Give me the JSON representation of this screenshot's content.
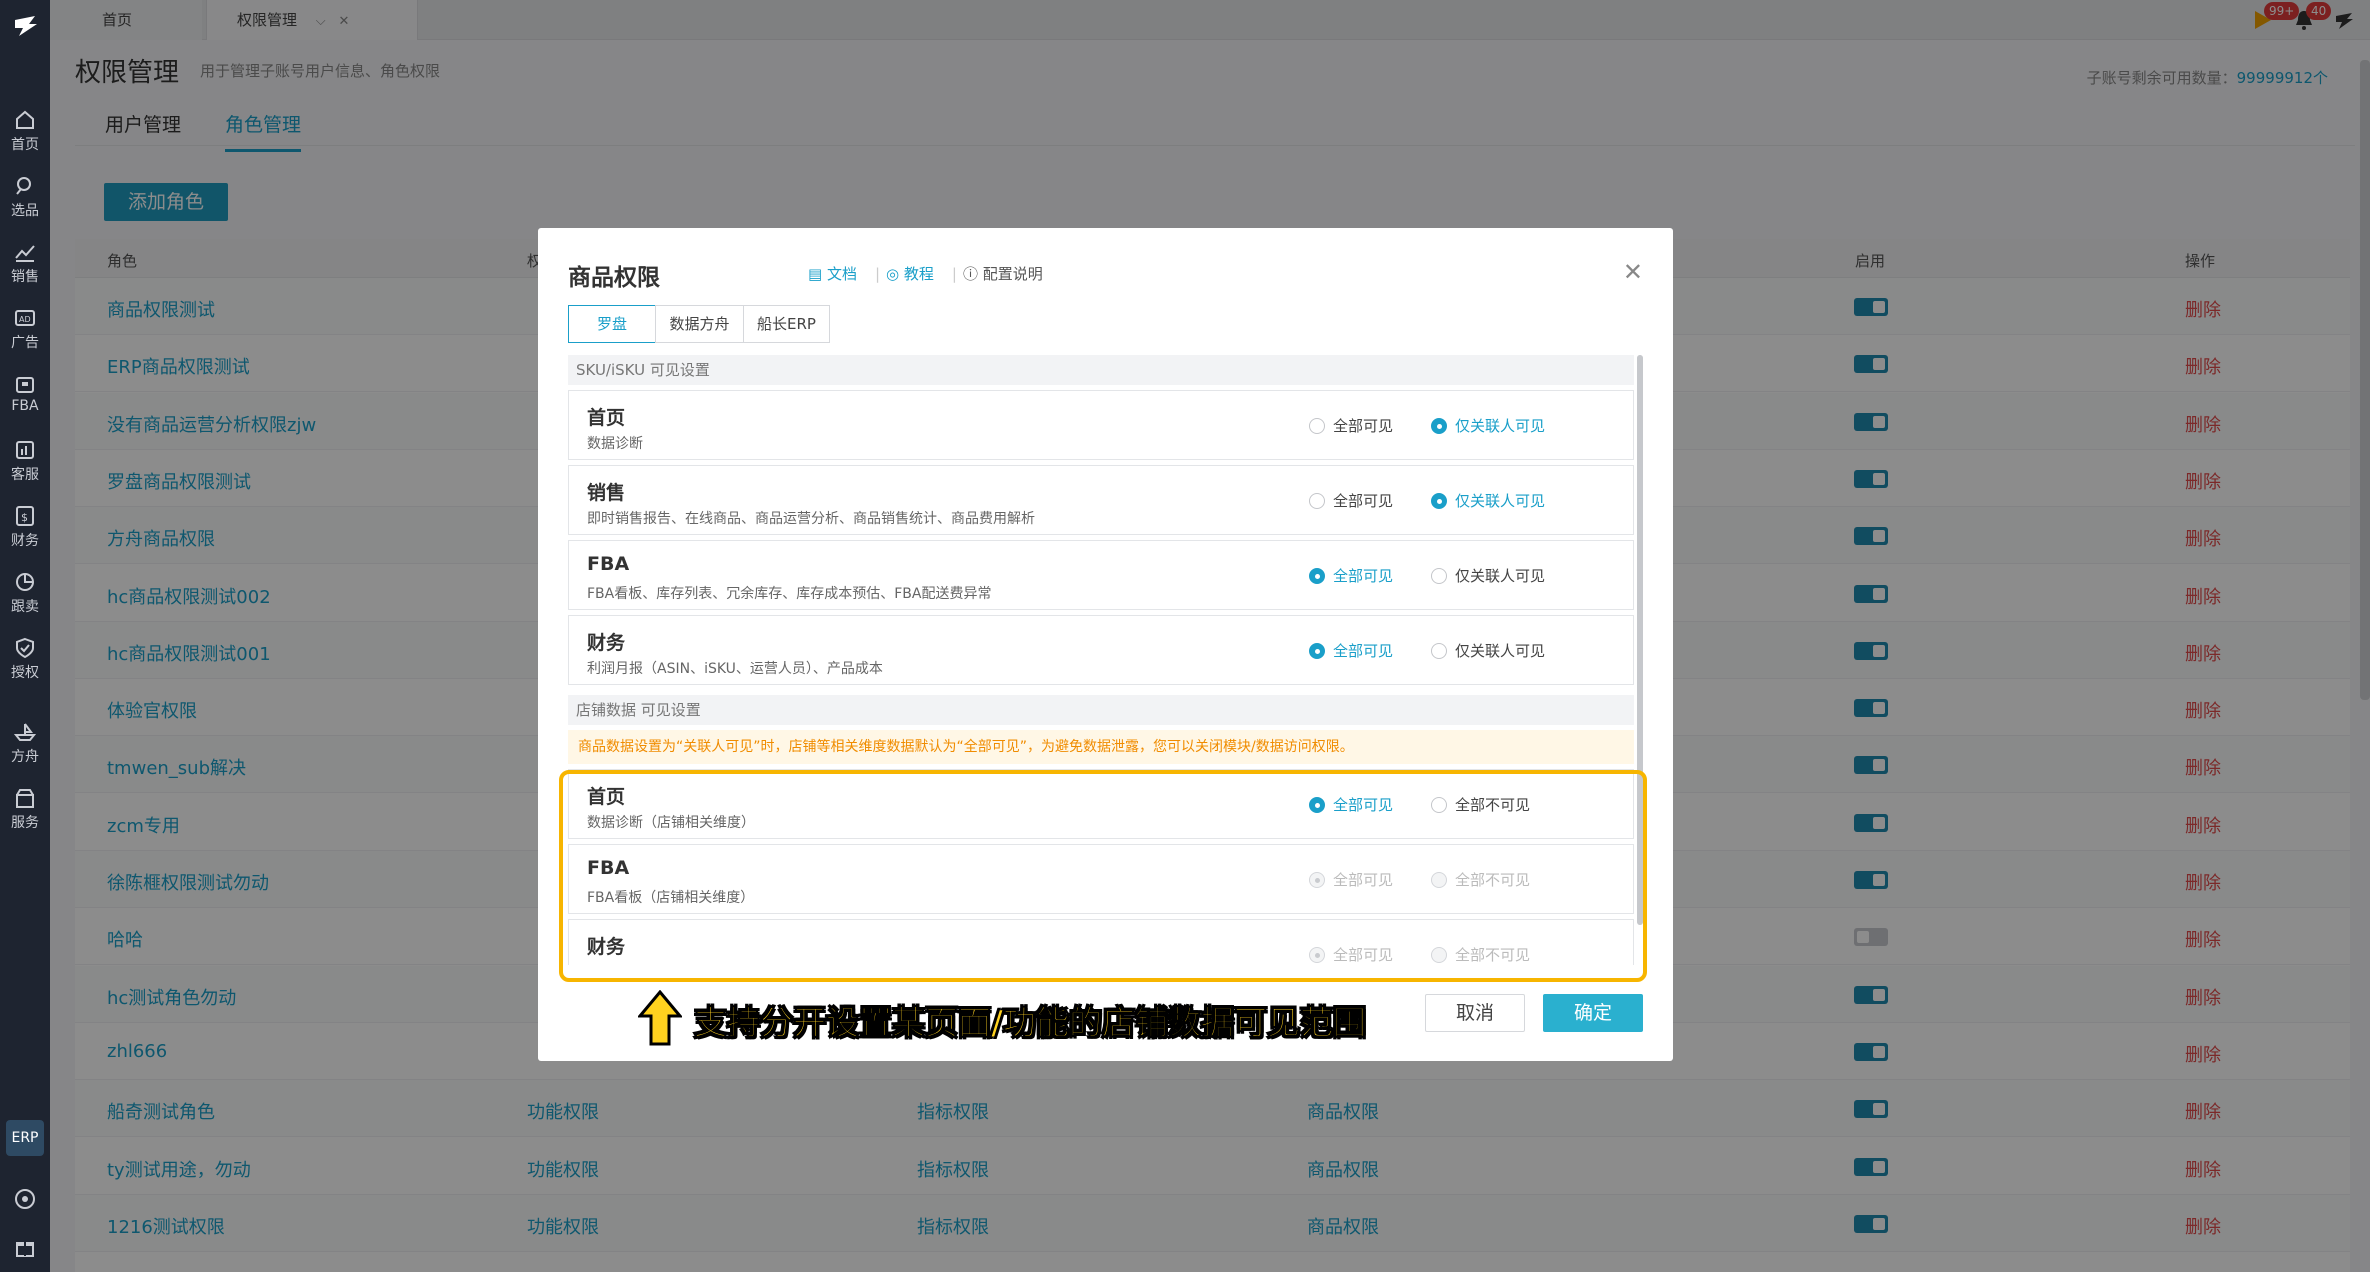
{
  "sidebar": {
    "items": [
      {
        "label": "首页",
        "icon": "home-icon"
      },
      {
        "label": "选品",
        "icon": "search-icon"
      },
      {
        "label": "销售",
        "icon": "chart-icon"
      },
      {
        "label": "广告",
        "icon": "ad-icon"
      },
      {
        "label": "FBA",
        "icon": "box-icon"
      },
      {
        "label": "客服",
        "icon": "service-icon"
      },
      {
        "label": "财务",
        "icon": "dollar-icon"
      },
      {
        "label": "跟卖",
        "icon": "pie-icon"
      },
      {
        "label": "授权",
        "icon": "shield-icon"
      },
      {
        "label": "方舟",
        "icon": "ark-icon"
      },
      {
        "label": "服务",
        "icon": "store-icon"
      }
    ],
    "erp_label": "ERP"
  },
  "topbar": {
    "tabs": [
      {
        "label": "首页"
      },
      {
        "label": "权限管理"
      }
    ],
    "badges": {
      "play": "99+",
      "bell": "40"
    }
  },
  "header": {
    "title": "权限管理",
    "subtitle": "用于管理子账号用户信息、角色权限",
    "quota_label": "子账号剩余可用数量：",
    "quota_value": "99999912个"
  },
  "subtabs": [
    {
      "label": "用户管理"
    },
    {
      "label": "角色管理"
    }
  ],
  "add_button": "添加角色",
  "table": {
    "headers": {
      "role": "角色",
      "col2": "权",
      "enabled": "启用",
      "ops": "操作"
    },
    "rows": [
      {
        "name": "商品权限测试",
        "c2": "",
        "c3": "",
        "c4": "",
        "enabled": true,
        "op": "删除"
      },
      {
        "name": "ERP商品权限测试",
        "c2": "",
        "c3": "",
        "c4": "",
        "enabled": true,
        "op": "删除"
      },
      {
        "name": "没有商品运营分析权限zjw",
        "c2": "",
        "c3": "",
        "c4": "",
        "enabled": true,
        "op": "删除"
      },
      {
        "name": "罗盘商品权限测试",
        "c2": "",
        "c3": "",
        "c4": "",
        "enabled": true,
        "op": "删除"
      },
      {
        "name": "方舟商品权限",
        "c2": "",
        "c3": "",
        "c4": "",
        "enabled": true,
        "op": "删除"
      },
      {
        "name": "hc商品权限测试002",
        "c2": "",
        "c3": "",
        "c4": "",
        "enabled": true,
        "op": "删除"
      },
      {
        "name": "hc商品权限测试001",
        "c2": "",
        "c3": "",
        "c4": "",
        "enabled": true,
        "op": "删除"
      },
      {
        "name": "体验官权限",
        "c2": "",
        "c3": "",
        "c4": "",
        "enabled": true,
        "op": "删除"
      },
      {
        "name": "tmwen_sub解决",
        "c2": "",
        "c3": "",
        "c4": "",
        "enabled": true,
        "op": "删除"
      },
      {
        "name": "zcm专用",
        "c2": "",
        "c3": "",
        "c4": "",
        "enabled": true,
        "op": "删除"
      },
      {
        "name": "徐陈榧权限测试勿动",
        "c2": "",
        "c3": "",
        "c4": "",
        "enabled": true,
        "op": "删除"
      },
      {
        "name": "哈哈",
        "c2": "",
        "c3": "",
        "c4": "",
        "enabled": false,
        "op": "删除"
      },
      {
        "name": "hc测试角色勿动",
        "c2": "",
        "c3": "",
        "c4": "",
        "enabled": true,
        "op": "删除"
      },
      {
        "name": "zhl666",
        "c2": "",
        "c3": "",
        "c4": "",
        "enabled": true,
        "op": "删除"
      },
      {
        "name": "船奇测试角色",
        "c2": "功能权限",
        "c3": "指标权限",
        "c4": "商品权限",
        "enabled": true,
        "op": "删除"
      },
      {
        "name": "ty测试用途，勿动",
        "c2": "功能权限",
        "c3": "指标权限",
        "c4": "商品权限",
        "enabled": true,
        "op": "删除"
      },
      {
        "name": "1216测试权限",
        "c2": "功能权限",
        "c3": "指标权限",
        "c4": "商品权限",
        "enabled": true,
        "op": "删除"
      }
    ]
  },
  "modal": {
    "title": "商品权限",
    "links": {
      "doc": "文档",
      "tutorial": "教程",
      "info": "配置说明"
    },
    "tabs": [
      {
        "label": "罗盘"
      },
      {
        "label": "数据方舟"
      },
      {
        "label": "船长ERP"
      }
    ],
    "sku_section": "SKU/iSKU 可见设置",
    "sku_items": [
      {
        "title": "首页",
        "desc": "数据诊断",
        "opt1": "全部可见",
        "opt2": "仅关联人可见",
        "selected": 2
      },
      {
        "title": "销售",
        "desc": "即时销售报告、在线商品、商品运营分析、商品销售统计、商品费用解析",
        "opt1": "全部可见",
        "opt2": "仅关联人可见",
        "selected": 2
      },
      {
        "title": "FBA",
        "desc": "FBA看板、库存列表、冗余库存、库存成本预估、FBA配送费异常",
        "opt1": "全部可见",
        "opt2": "仅关联人可见",
        "selected": 1
      },
      {
        "title": "财务",
        "desc": "利润月报（ASIN、iSKU、运营人员）、产品成本",
        "opt1": "全部可见",
        "opt2": "仅关联人可见",
        "selected": 1
      }
    ],
    "store_section": "店铺数据 可见设置",
    "store_warning": "商品数据设置为“关联人可见”时，店铺等相关维度数据默认为“全部可见”，为避免数据泄露，您可以关闭模块/数据访问权限。",
    "store_items": [
      {
        "title": "首页",
        "desc": "数据诊断（店铺相关维度）",
        "opt1": "全部可见",
        "opt2": "全部不可见",
        "selected": 1,
        "disabled": false
      },
      {
        "title": "FBA",
        "desc": "FBA看板（店铺相关维度）",
        "opt1": "全部可见",
        "opt2": "全部不可见",
        "selected": 1,
        "disabled": true
      },
      {
        "title": "财务",
        "desc": "",
        "opt1": "全部可见",
        "opt2": "全部不可见",
        "selected": 1,
        "disabled": true
      }
    ],
    "cancel": "取消",
    "ok": "确定"
  },
  "callout": "支持分开设置某页面/功能的店铺数据可见范围",
  "colors": {
    "accent": "#1a9fc9",
    "danger": "#e24b4b",
    "highlight": "#f7b500"
  }
}
